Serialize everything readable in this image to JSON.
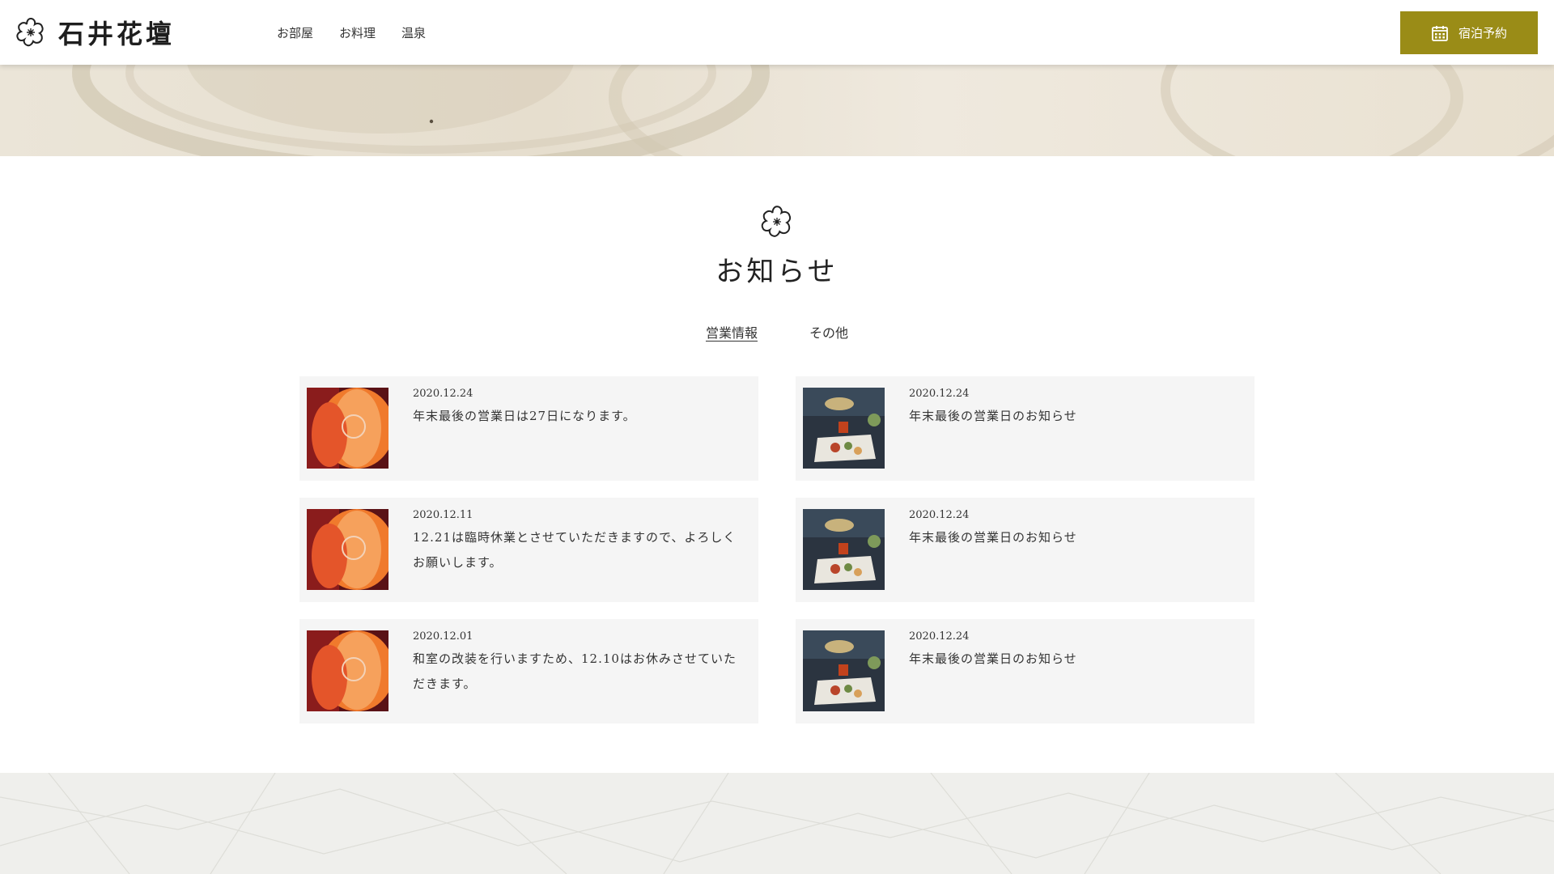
{
  "header": {
    "logo_text": "石井花壇",
    "nav": [
      {
        "label": "お部屋"
      },
      {
        "label": "お料理"
      },
      {
        "label": "温泉"
      }
    ],
    "reserve_label": "宿泊予約",
    "reserve_color": "#9a8c17"
  },
  "section": {
    "title": "お知らせ",
    "tabs": [
      {
        "label": "営業情報",
        "active": true
      },
      {
        "label": "その他",
        "active": false
      }
    ]
  },
  "news": [
    {
      "date": "2020.12.24",
      "title": "年末最後の営業日は27日になります。",
      "image": "lantern"
    },
    {
      "date": "2020.12.24",
      "title": "年末最後の営業日のお知らせ",
      "image": "dish"
    },
    {
      "date": "2020.12.11",
      "title": "12.21は臨時休業とさせていただきますので、よろしくお願いします。",
      "image": "lantern"
    },
    {
      "date": "2020.12.24",
      "title": "年末最後の営業日のお知らせ",
      "image": "dish"
    },
    {
      "date": "2020.12.01",
      "title": "和室の改装を行いますため、12.10はお休みさせていただきます。",
      "image": "lantern"
    },
    {
      "date": "2020.12.24",
      "title": "年末最後の営業日のお知らせ",
      "image": "dish"
    }
  ]
}
